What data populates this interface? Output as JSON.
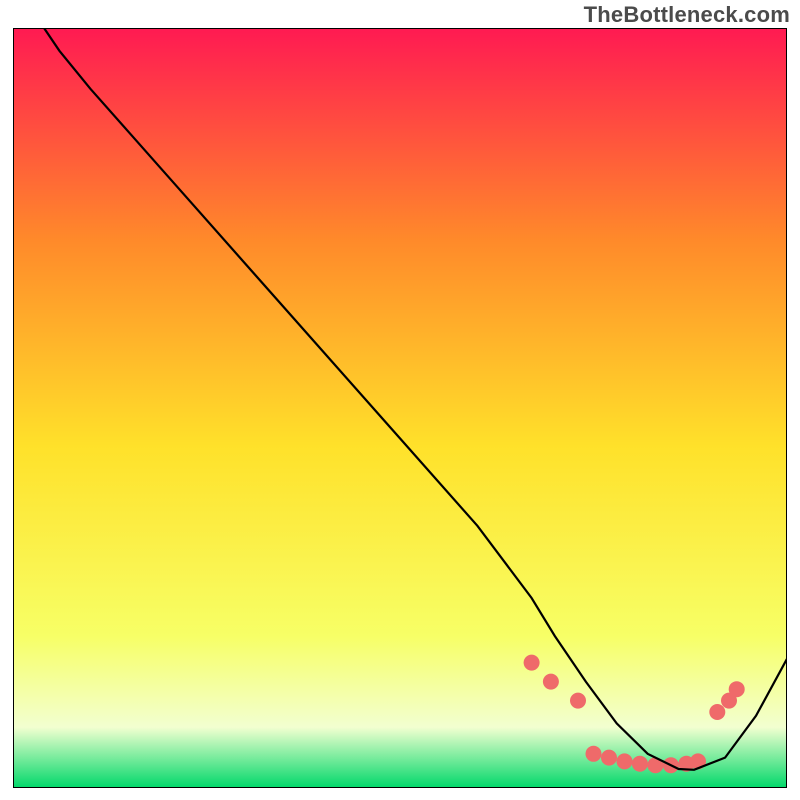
{
  "watermark": "TheBottleneck.com",
  "colors": {
    "gradient_top": "#ff1a52",
    "gradient_mid_upper": "#ff8a2a",
    "gradient_mid": "#ffe12a",
    "gradient_lower": "#f7ff66",
    "gradient_pale": "#f2ffd0",
    "gradient_bottom": "#00d86a",
    "curve": "#000000",
    "dots": "#ef6a6a",
    "border": "#000000"
  },
  "chart_data": {
    "type": "line",
    "title": "",
    "xlabel": "",
    "ylabel": "",
    "xlim": [
      0,
      100
    ],
    "ylim": [
      0,
      100
    ],
    "series": [
      {
        "name": "bottleneck-curve",
        "x": [
          4,
          6,
          10,
          20,
          30,
          40,
          50,
          60,
          67,
          70,
          74,
          78,
          82,
          86,
          88,
          92,
          96,
          100
        ],
        "y": [
          100,
          97,
          92,
          80.5,
          69,
          57.5,
          46,
          34.5,
          25,
          20,
          14,
          8.5,
          4.5,
          2.5,
          2.4,
          4,
          9.5,
          17
        ]
      }
    ],
    "annotations": [
      {
        "name": "valley-dots",
        "x": [
          67,
          69.5,
          73,
          75,
          77,
          79,
          81,
          83,
          85,
          87,
          88.5,
          91,
          92.5,
          93.5
        ],
        "y": [
          16.5,
          14,
          11.5,
          4.5,
          4,
          3.5,
          3.2,
          3,
          3,
          3.2,
          3.5,
          10,
          11.5,
          13
        ]
      }
    ]
  }
}
